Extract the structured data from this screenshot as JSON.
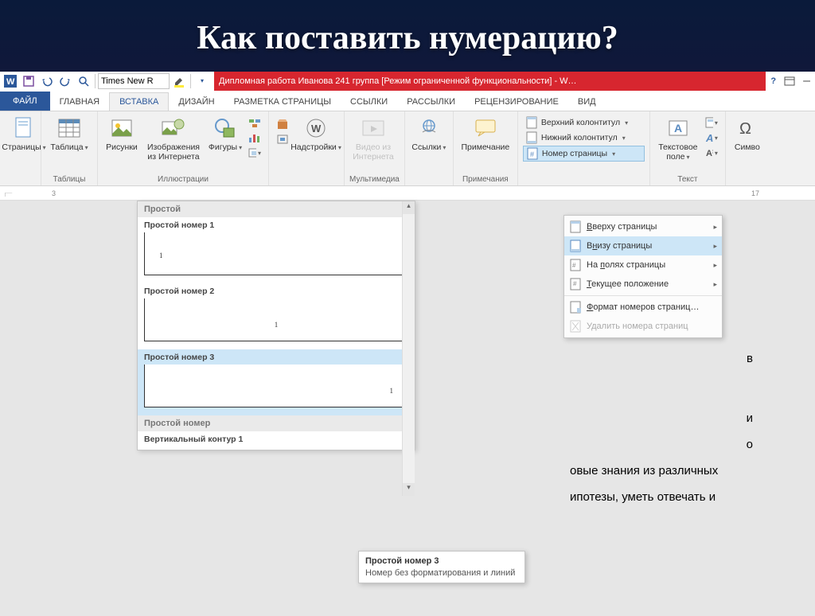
{
  "slide": {
    "title": "Как поставить нумерацию?"
  },
  "titlebar": {
    "text": "Дипломная работа Иванова 241 группа [Режим ограниченной функциональности]  -  W…"
  },
  "qat": {
    "font": "Times New R"
  },
  "tabs": {
    "file": "ФАЙЛ",
    "items": [
      "ГЛАВНАЯ",
      "ВСТАВКА",
      "ДИЗАЙН",
      "РАЗМЕТКА СТРАНИЦЫ",
      "ССЫЛКИ",
      "РАССЫЛКИ",
      "РЕЦЕНЗИРОВАНИЕ",
      "ВИД"
    ],
    "active": 1
  },
  "ribbon": {
    "pages": "Страницы",
    "table": "Таблица",
    "tables_grp": "Таблицы",
    "pictures": "Рисунки",
    "online_pictures": "Изображения\nиз Интернета",
    "shapes": "Фигуры",
    "illustrations_grp": "Иллюстрации",
    "addins": "Надстройки",
    "online_video": "Видео из\nИнтернета",
    "multimedia_grp": "Мультимедиа",
    "links": "Ссылки",
    "comment": "Примечание",
    "comments_grp": "Примечания",
    "header": "Верхний колонтитул",
    "footer": "Нижний колонтитул",
    "page_number": "Номер страницы",
    "textbox": "Текстовое\nполе",
    "text_grp": "Текст",
    "symbol": "Симво"
  },
  "submenu": {
    "top": "Вверху страницы",
    "bottom": "Внизу страницы",
    "margins": "На полях страницы",
    "current": "Текущее положение",
    "format": "Формат номеров страниц…",
    "remove": "Удалить номера страниц"
  },
  "gallery": {
    "section": "Простой",
    "item1": "Простой номер 1",
    "item2": "Простой номер 2",
    "item3": "Простой номер 3",
    "simple_num": "Простой номер",
    "vertical": "Вертикальный контур 1",
    "num": "1"
  },
  "tooltip": {
    "title": "Простой номер 3",
    "body": "Номер без форматирования и линий"
  },
  "doc": {
    "suffix_v": "в",
    "suffix_i": "и",
    "suffix_o": "о",
    "line1": "овые знания из различных",
    "line2": "ипотезы, уметь отвечать и"
  },
  "ruler": {
    "m1": "3",
    "m17": "17"
  }
}
